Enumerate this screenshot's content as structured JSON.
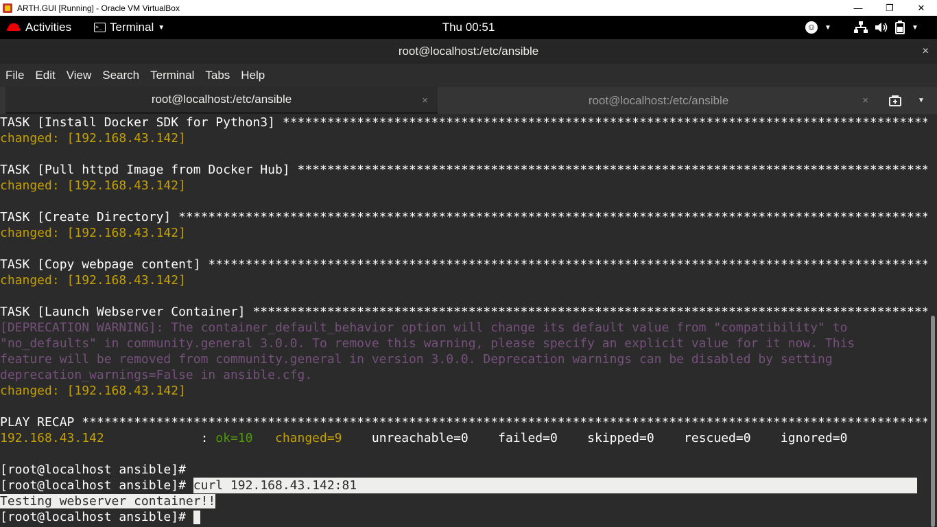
{
  "vbox": {
    "title": "ARTH.GUI [Running] - Oracle VM VirtualBox",
    "minimize": "—",
    "restore": "❐",
    "close": "✕"
  },
  "gnome": {
    "activities": "Activities",
    "app_menu": "Terminal",
    "clock": "Thu 00:51"
  },
  "terminal": {
    "window_title": "root@localhost:/etc/ansible",
    "close": "×",
    "menu": [
      "File",
      "Edit",
      "View",
      "Search",
      "Terminal",
      "Tabs",
      "Help"
    ],
    "tabs": [
      {
        "label": "root@localhost:/etc/ansible",
        "close": "×"
      },
      {
        "label": "root@localhost:/etc/ansible",
        "close": "×"
      }
    ]
  },
  "output": {
    "task1": "TASK [Install Docker SDK for Python3] *******************************************************************************************",
    "changed": "changed: [192.168.43.142]",
    "task2": "TASK [Pull httpd Image from Docker Hub] *****************************************************************************************",
    "task3": "TASK [Create Directory] *****************************************************************************************************************************",
    "task4": "TASK [Copy webpage content] *************************************************************************************************************",
    "task5": "TASK [Launch Webserver Container] **********************************************************************************************",
    "warn1": "[DEPRECATION WARNING]: The container_default_behavior option will change its default value from \"compatibility\" to",
    "warn2": "\"no_defaults\" in community.general 3.0.0. To remove this warning, please specify an explicit value for it now. This",
    "warn3": "feature will be removed from community.general in version 3.0.0. Deprecation warnings can be disabled by setting",
    "warn4": "deprecation_warnings=False in ansible.cfg.",
    "recap": "PLAY RECAP ******************************************************************************************************************************",
    "recap_host": "192.168.43.142",
    "recap_colon": "             : ",
    "recap_ok": "ok=10",
    "recap_changed": "changed=9",
    "recap_rest": "    unreachable=0    failed=0    skipped=0    rescued=0    ignored=0",
    "prompt": "[root@localhost ansible]#",
    "command": "curl 192.168.43.142:81",
    "response": "Testing webserver container!!"
  }
}
